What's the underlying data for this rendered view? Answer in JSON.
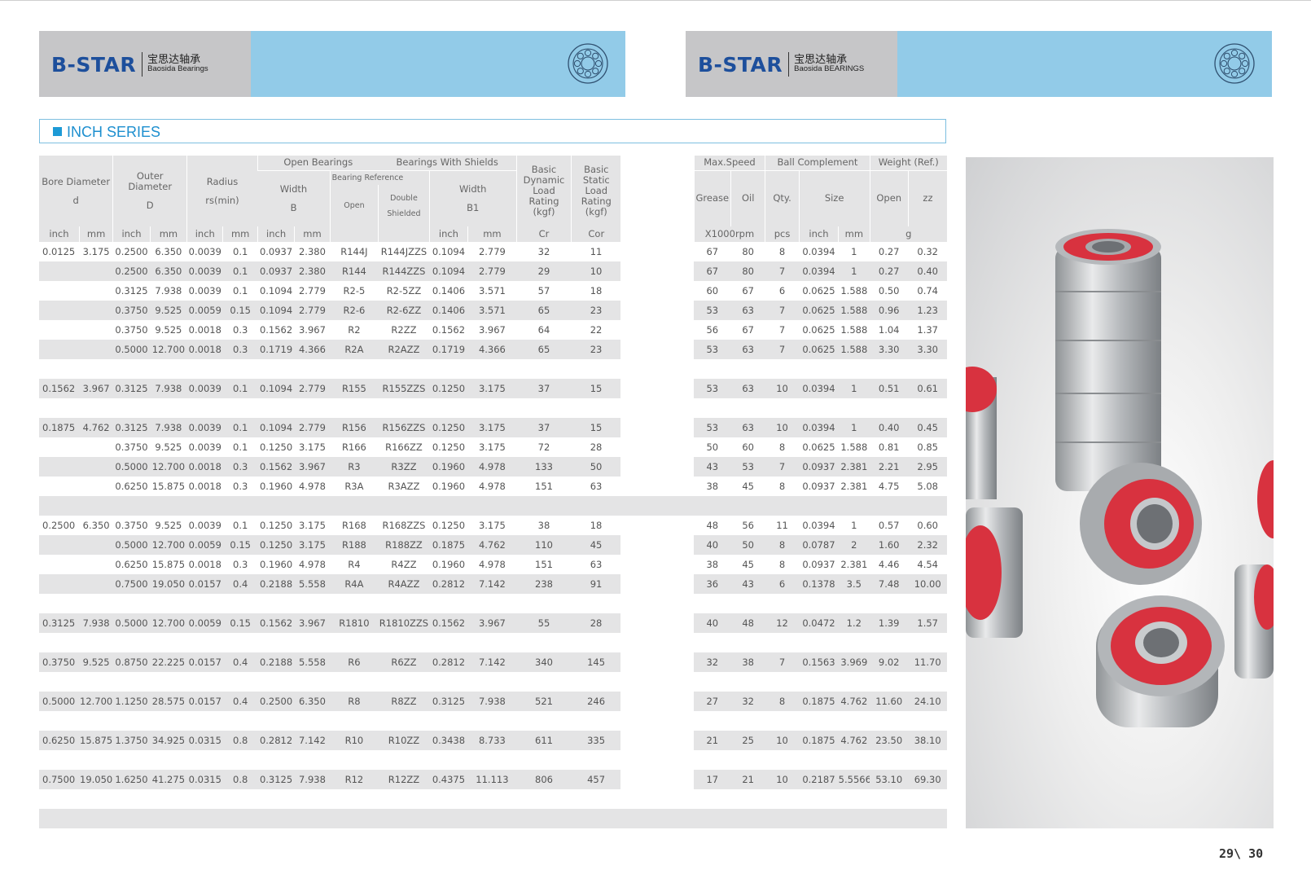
{
  "banner_left": {
    "brand": "B-STAR",
    "cn": "宝思达轴承",
    "en": "Baosida Bearings"
  },
  "banner_right": {
    "brand": "B-STAR",
    "cn": "宝思达轴承",
    "en": "Baosida BEARINGS"
  },
  "section_title": "INCH SERIES",
  "headers": {
    "bore": "Bore  Diameter",
    "bore_sym": "d",
    "outer": "Outer Diameter",
    "outer_sym": "D",
    "radius": "Radius",
    "radius_sym": "rs(min)",
    "open_bearings": "Open Bearings",
    "with_shields": "Bearings With Shields",
    "width": "Width",
    "width_sym": "B",
    "bearing_ref": "Bearing Reference",
    "open": "Open",
    "double": "Double",
    "shielded": "Shielded",
    "width_b1": "Width",
    "width_b1_sym": "B1",
    "dyn": "Basic Dynamic Load Rating (kgf)",
    "stat": "Basic Static Load Rating (kgf)",
    "max_speed": "Max.Speed",
    "grease": "Grease",
    "oil": "Oil",
    "ball_complement": "Ball Complement",
    "qty": "Qty.",
    "size": "Size",
    "weight": "Weight  (Ref.)",
    "w_open": "Open",
    "w_zz": "zz",
    "u_inch": "inch",
    "u_mm": "mm",
    "u_cr": "Cr",
    "u_cor": "Cor",
    "u_rpm": "X1000rpm",
    "u_pcs": "pcs",
    "u_g": "g"
  },
  "rows": [
    [
      "0.0125",
      "3.175",
      "0.2500",
      "6.350",
      "0.0039",
      "0.1",
      "0.0937",
      "2.380",
      "R144J",
      "R144JZZS",
      "0.1094",
      "2.779",
      "32",
      "11",
      "67",
      "80",
      "8",
      "0.0394",
      "1",
      "0.27",
      "0.32"
    ],
    [
      "",
      "",
      "0.2500",
      "6.350",
      "0.0039",
      "0.1",
      "0.0937",
      "2.380",
      "R144",
      "R144ZZS",
      "0.1094",
      "2.779",
      "29",
      "10",
      "67",
      "80",
      "7",
      "0.0394",
      "1",
      "0.27",
      "0.40"
    ],
    [
      "",
      "",
      "0.3125",
      "7.938",
      "0.0039",
      "0.1",
      "0.1094",
      "2.779",
      "R2-5",
      "R2-5ZZ",
      "0.1406",
      "3.571",
      "57",
      "18",
      "60",
      "67",
      "6",
      "0.0625",
      "1.588",
      "0.50",
      "0.74"
    ],
    [
      "",
      "",
      "0.3750",
      "9.525",
      "0.0059",
      "0.15",
      "0.1094",
      "2.779",
      "R2-6",
      "R2-6ZZ",
      "0.1406",
      "3.571",
      "65",
      "23",
      "53",
      "63",
      "7",
      "0.0625",
      "1.588",
      "0.96",
      "1.23"
    ],
    [
      "",
      "",
      "0.3750",
      "9.525",
      "0.0018",
      "0.3",
      "0.1562",
      "3.967",
      "R2",
      "R2ZZ",
      "0.1562",
      "3.967",
      "64",
      "22",
      "56",
      "67",
      "7",
      "0.0625",
      "1.588",
      "1.04",
      "1.37"
    ],
    [
      "",
      "",
      "0.5000",
      "12.700",
      "0.0018",
      "0.3",
      "0.1719",
      "4.366",
      "R2A",
      "R2AZZ",
      "0.1719",
      "4.366",
      "65",
      "23",
      "53",
      "63",
      "7",
      "0.0625",
      "1.588",
      "3.30",
      "3.30"
    ],
    [],
    [
      "0.1562",
      "3.967",
      "0.3125",
      "7.938",
      "0.0039",
      "0.1",
      "0.1094",
      "2.779",
      "R155",
      "R155ZZS",
      "0.1250",
      "3.175",
      "37",
      "15",
      "53",
      "63",
      "10",
      "0.0394",
      "1",
      "0.51",
      "0.61"
    ],
    [],
    [
      "0.1875",
      "4.762",
      "0.3125",
      "7.938",
      "0.0039",
      "0.1",
      "0.1094",
      "2.779",
      "R156",
      "R156ZZS",
      "0.1250",
      "3.175",
      "37",
      "15",
      "53",
      "63",
      "10",
      "0.0394",
      "1",
      "0.40",
      "0.45"
    ],
    [
      "",
      "",
      "0.3750",
      "9.525",
      "0.0039",
      "0.1",
      "0.1250",
      "3.175",
      "R166",
      "R166ZZ",
      "0.1250",
      "3.175",
      "72",
      "28",
      "50",
      "60",
      "8",
      "0.0625",
      "1.588",
      "0.81",
      "0.85"
    ],
    [
      "",
      "",
      "0.5000",
      "12.700",
      "0.0018",
      "0.3",
      "0.1562",
      "3.967",
      "R3",
      "R3ZZ",
      "0.1960",
      "4.978",
      "133",
      "50",
      "43",
      "53",
      "7",
      "0.0937",
      "2.381",
      "2.21",
      "2.95"
    ],
    [
      "",
      "",
      "0.6250",
      "15.875",
      "0.0018",
      "0.3",
      "0.1960",
      "4.978",
      "R3A",
      "R3AZZ",
      "0.1960",
      "4.978",
      "151",
      "63",
      "38",
      "45",
      "8",
      "0.0937",
      "2.381",
      "4.75",
      "5.08"
    ],
    [],
    [
      "0.2500",
      "6.350",
      "0.3750",
      "9.525",
      "0.0039",
      "0.1",
      "0.1250",
      "3.175",
      "R168",
      "R168ZZS",
      "0.1250",
      "3.175",
      "38",
      "18",
      "48",
      "56",
      "11",
      "0.0394",
      "1",
      "0.57",
      "0.60"
    ],
    [
      "",
      "",
      "0.5000",
      "12.700",
      "0.0059",
      "0.15",
      "0.1250",
      "3.175",
      "R188",
      "R188ZZ",
      "0.1875",
      "4.762",
      "110",
      "45",
      "40",
      "50",
      "8",
      "0.0787",
      "2",
      "1.60",
      "2.32"
    ],
    [
      "",
      "",
      "0.6250",
      "15.875",
      "0.0018",
      "0.3",
      "0.1960",
      "4.978",
      "R4",
      "R4ZZ",
      "0.1960",
      "4.978",
      "151",
      "63",
      "38",
      "45",
      "8",
      "0.0937",
      "2.381",
      "4.46",
      "4.54"
    ],
    [
      "",
      "",
      "0.7500",
      "19.050",
      "0.0157",
      "0.4",
      "0.2188",
      "5.558",
      "R4A",
      "R4AZZ",
      "0.2812",
      "7.142",
      "238",
      "91",
      "36",
      "43",
      "6",
      "0.1378",
      "3.5",
      "7.48",
      "10.00"
    ],
    [],
    [
      "0.3125",
      "7.938",
      "0.5000",
      "12.700",
      "0.0059",
      "0.15",
      "0.1562",
      "3.967",
      "R1810",
      "R1810ZZS",
      "0.1562",
      "3.967",
      "55",
      "28",
      "40",
      "48",
      "12",
      "0.0472",
      "1.2",
      "1.39",
      "1.57"
    ],
    [],
    [
      "0.3750",
      "9.525",
      "0.8750",
      "22.225",
      "0.0157",
      "0.4",
      "0.2188",
      "5.558",
      "R6",
      "R6ZZ",
      "0.2812",
      "7.142",
      "340",
      "145",
      "32",
      "38",
      "7",
      "0.1563",
      "3.969",
      "9.02",
      "11.70"
    ],
    [],
    [
      "0.5000",
      "12.700",
      "1.1250",
      "28.575",
      "0.0157",
      "0.4",
      "0.2500",
      "6.350",
      "R8",
      "R8ZZ",
      "0.3125",
      "7.938",
      "521",
      "246",
      "27",
      "32",
      "8",
      "0.1875",
      "4.762",
      "11.60",
      "24.10"
    ],
    [],
    [
      "0.6250",
      "15.875",
      "1.3750",
      "34.925",
      "0.0315",
      "0.8",
      "0.2812",
      "7.142",
      "R10",
      "R10ZZ",
      "0.3438",
      "8.733",
      "611",
      "335",
      "21",
      "25",
      "10",
      "0.1875",
      "4.762",
      "23.50",
      "38.10"
    ],
    [],
    [
      "0.7500",
      "19.050",
      "1.6250",
      "41.275",
      "0.0315",
      "0.8",
      "0.3125",
      "7.938",
      "R12",
      "R12ZZ",
      "0.4375",
      "11.113",
      "806",
      "457",
      "17",
      "21",
      "10",
      "0.2187",
      "5.5566",
      "53.10",
      "69.30"
    ],
    [],
    []
  ],
  "page_number": "29\\ 30",
  "colors": {
    "banner_grey": "#c6c6c8",
    "banner_blue": "#92cbe8",
    "brand_blue": "#1d4f9c",
    "accent": "#1d9ad6",
    "row_grey": "#e4e4e5"
  }
}
